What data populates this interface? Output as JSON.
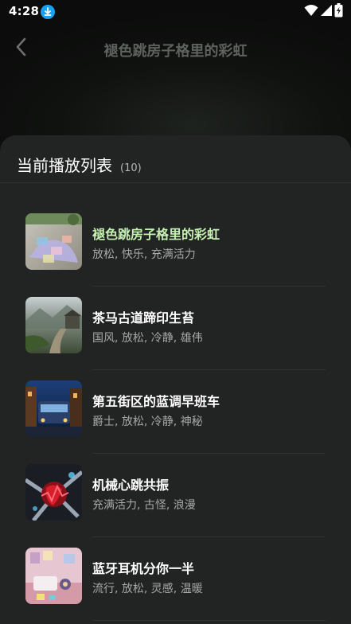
{
  "status_bar": {
    "time": "4:28",
    "icons": [
      "download-badge-icon",
      "wifi-icon",
      "signal-icon",
      "battery-icon"
    ]
  },
  "header": {
    "title": "褪色跳房子格里的彩虹",
    "back_icon": "chevron-left-icon"
  },
  "playlist": {
    "title": "当前播放列表",
    "count": "(10)",
    "items": [
      {
        "title": "褪色跳房子格里的彩虹",
        "tags": "放松, 快乐, 充满活力",
        "active": true
      },
      {
        "title": "茶马古道蹄印生苔",
        "tags": "国风, 放松, 冷静, 雄伟",
        "active": false
      },
      {
        "title": "第五街区的蓝调早班车",
        "tags": "爵士, 放松, 冷静, 神秘",
        "active": false
      },
      {
        "title": "机械心跳共振",
        "tags": "充满活力, 古怪, 浪漫",
        "active": false
      },
      {
        "title": "蓝牙耳机分你一半",
        "tags": "流行, 放松, 灵感, 温暖",
        "active": false
      }
    ]
  },
  "colors": {
    "active_title": "#c6f1b3",
    "sheet_bg": "#222323",
    "accent_blue": "#1aa0f0"
  }
}
